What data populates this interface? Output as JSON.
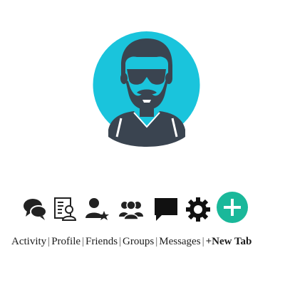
{
  "avatar": {
    "bg_color": "#1ac4dc",
    "fg_color": "#3a4450",
    "icon": "bearded-man-sunglasses-avatar"
  },
  "nav": {
    "items": [
      {
        "label": "Activity",
        "icon": "chat-bubbles-icon"
      },
      {
        "label": "Profile",
        "icon": "profile-card-icon"
      },
      {
        "label": "Friends",
        "icon": "user-star-icon"
      },
      {
        "label": "Groups",
        "icon": "group-icon"
      },
      {
        "label": "Messages",
        "icon": "message-bubble-icon"
      },
      {
        "label": "+New Tab",
        "icon": "gear-icon"
      }
    ],
    "separator": "|",
    "add_button": {
      "icon": "plus-icon",
      "color": "#1ab89a"
    }
  }
}
